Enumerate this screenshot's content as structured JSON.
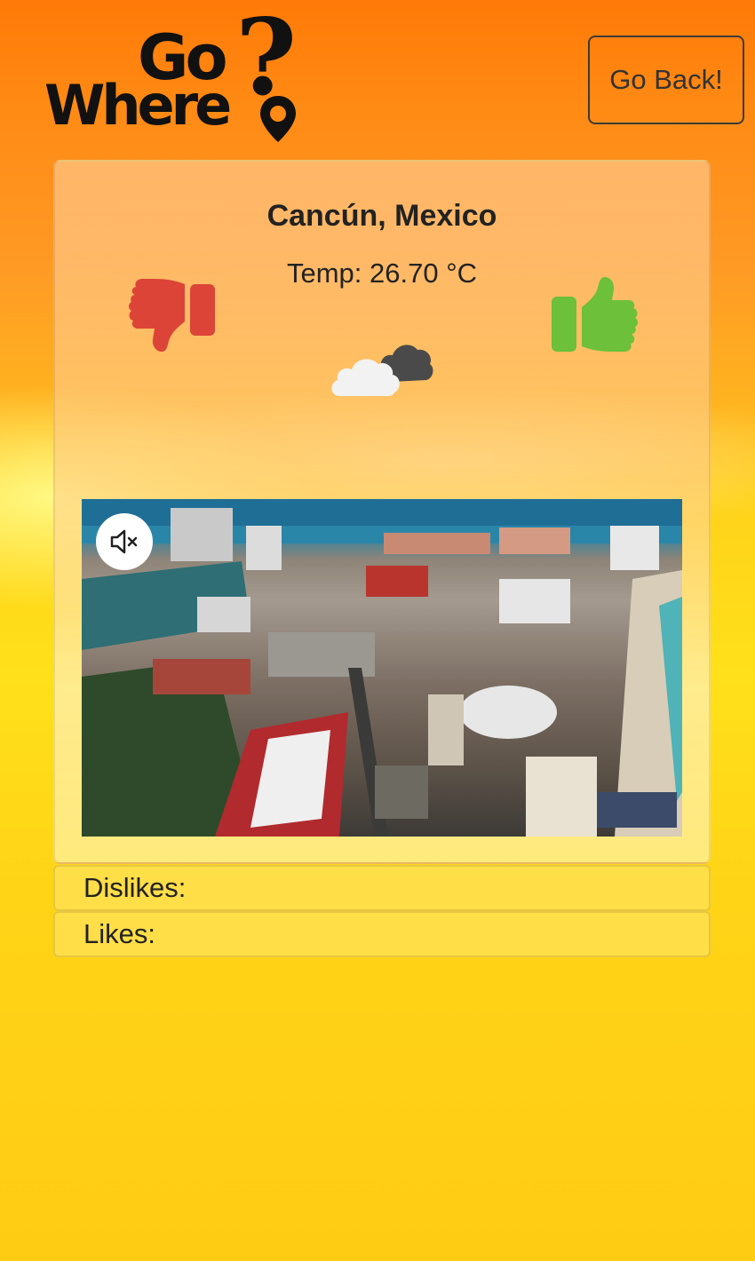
{
  "header": {
    "logo": {
      "word_top": "Go",
      "word_bottom": "Where",
      "mark": "?",
      "pin_icon": "map-pin-icon"
    },
    "back_button_label": "Go Back!"
  },
  "destination": {
    "city": "Cancún, Mexico",
    "temp_label": "Temp: 26.70 °C",
    "weather_icon": "cloudy-icon",
    "dislike_icon": "thumbs-down-icon",
    "like_icon": "thumbs-up-icon"
  },
  "video": {
    "muted": true,
    "mute_icon": "volume-mute-icon"
  },
  "stats": {
    "dislikes_label": "Dislikes:",
    "likes_label": "Likes:"
  },
  "colors": {
    "thumbs_down": "#dc4438",
    "thumbs_up": "#6cc03a",
    "background_top": "#ff7a07",
    "background_bottom": "#ffcc14"
  }
}
